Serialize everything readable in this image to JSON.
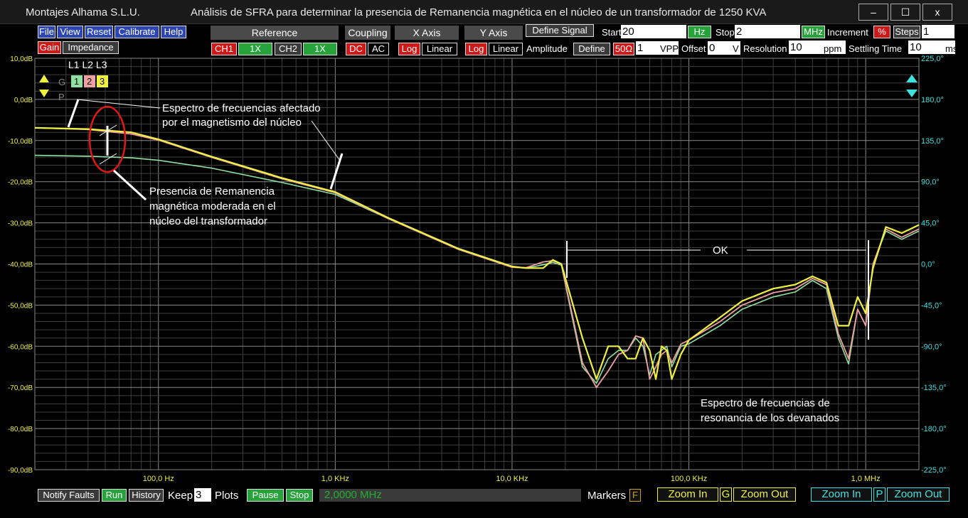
{
  "window": {
    "company": "Montajes Alhama S.L.U.",
    "title": "Análisis de SFRA para determinar la presencia de Remanencia magnética en el núcleo de un transformador de 1250 KVA",
    "minimize": "–",
    "maximize": "☐",
    "close": "x"
  },
  "menu": {
    "file": "File",
    "view": "View",
    "reset": "Reset",
    "calibrate": "Calibrate",
    "help": "Help"
  },
  "mode": {
    "gain": "Gain",
    "impedance": "Impedance"
  },
  "reference": {
    "header": "Reference",
    "ch1": "CH1",
    "ch1_mult": "1X",
    "ch2": "CH2",
    "ch2_mult": "1X"
  },
  "coupling": {
    "header": "Coupling",
    "dc": "DC",
    "ac": "AC"
  },
  "xaxis": {
    "header": "X Axis",
    "log": "Log",
    "linear": "Linear"
  },
  "yaxis": {
    "header": "Y Axis",
    "log": "Log",
    "linear": "Linear"
  },
  "signal": {
    "define_signal": "Define Signal",
    "amplitude_label": "Amplitude",
    "define": "Define",
    "impedance": "50Ω",
    "amplitude_value": "1",
    "amplitude_unit": "VPP",
    "offset_label": "Offset",
    "offset_value": "0",
    "offset_unit": "V"
  },
  "sweep": {
    "start_label": "Start",
    "start_value": "20",
    "start_unit": "Hz",
    "stop_label": "Stop",
    "stop_value": "2",
    "stop_unit": "MHz",
    "increment_label": "Increment",
    "increment_unit": "%",
    "steps_label": "Steps",
    "steps_value": "1",
    "resolution_label": "Resolution",
    "resolution_value": "10",
    "resolution_unit": "ppm",
    "settling_label": "Settling Time",
    "settling_value": "10",
    "settling_unit": "ms"
  },
  "legend": {
    "header": "L1 L2 L3",
    "g": "G",
    "p": "P",
    "l1": "1",
    "l2": "2",
    "l3": "3"
  },
  "bottom": {
    "notify": "Notify Faults",
    "run": "Run",
    "history": "History",
    "keep_label": "Keep",
    "keep_value": "3",
    "plots_label": "Plots",
    "pause": "Pause",
    "stop": "Stop",
    "frequency": "2,0000 MHz",
    "markers": "Markers",
    "markers_flag": "F",
    "zoom_in_g": "Zoom In",
    "g": "G",
    "zoom_out_g": "Zoom Out",
    "zoom_in_p": "Zoom In",
    "p": "P",
    "zoom_out_p": "Zoom Out"
  },
  "colors": {
    "l1": "#90e0a0",
    "l2": "#f0a0a0",
    "l3": "#f0f040",
    "grid_major": "#8a8a8a",
    "grid_minor": "#3e3e3e",
    "left_axis": "#f0f040",
    "right_axis": "#40e0e0"
  },
  "chart_data": {
    "type": "line",
    "x_scale": "log",
    "xlim": [
      20,
      2000000
    ],
    "ylim": [
      -90,
      10
    ],
    "y2lim": [
      -225,
      225
    ],
    "x_ticks": [
      100,
      1000,
      10000,
      100000,
      1000000
    ],
    "x_tick_labels": [
      "100,0 Hz",
      "1,0 KHz",
      "10,0 KHz",
      "100,0 KHz",
      "1,0 MHz"
    ],
    "y_ticks": [
      10,
      0,
      -10,
      -20,
      -30,
      -40,
      -50,
      -60,
      -70,
      -80,
      -90
    ],
    "y_tick_labels": [
      "10,0dB",
      "0,0dB",
      "-10,0dB",
      "-20,0dB",
      "-30,0dB",
      "-40,0dB",
      "-50,0dB",
      "-60,0dB",
      "-70,0dB",
      "-80,0dB",
      "-90,0dB"
    ],
    "y2_ticks": [
      225,
      180,
      135,
      90,
      45,
      0,
      -45,
      -90,
      -135,
      -180,
      -225
    ],
    "y2_tick_labels": [
      "225,0°",
      "180,0°",
      "135,0°",
      "90,0°",
      "45,0°",
      "0,0°",
      "-45,0°",
      "-90,0°",
      "-135,0°",
      "-180,0°",
      "-225,0°"
    ],
    "grid": true,
    "series": [
      {
        "name": "1",
        "x": [
          20,
          40,
          70,
          100,
          200,
          500,
          1000,
          2000,
          5000,
          10000,
          12000,
          15000,
          17000,
          19000,
          25000,
          30000,
          35000,
          40000,
          45000,
          50000,
          55000,
          60000,
          65000,
          70000,
          75000,
          80000,
          90000,
          100000,
          150000,
          200000,
          300000,
          400000,
          500000,
          600000,
          700000,
          800000,
          900000,
          1000000,
          1100000,
          1300000,
          1600000,
          2000000
        ],
        "y": [
          -13.6,
          -13.8,
          -14.2,
          -14.8,
          -16.7,
          -20.2,
          -23.1,
          -29.0,
          -36.5,
          -40.8,
          -41.0,
          -40.2,
          -39.6,
          -40.3,
          -65.0,
          -69.0,
          -63.0,
          -61.0,
          -61.0,
          -58.0,
          -60.0,
          -67.0,
          -62.0,
          -61.0,
          -60.0,
          -65.0,
          -60.0,
          -59.4,
          -55.0,
          -51.0,
          -48.0,
          -46.8,
          -44.0,
          -46.0,
          -58.0,
          -64.3,
          -51.0,
          -55.0,
          -40.0,
          -32.0,
          -34.0,
          -32.0
        ]
      },
      {
        "name": "2",
        "x": [
          20,
          40,
          70,
          100,
          200,
          500,
          1000,
          2000,
          5000,
          10000,
          12000,
          15000,
          17000,
          19000,
          25000,
          30000,
          35000,
          40000,
          45000,
          50000,
          55000,
          60000,
          65000,
          70000,
          75000,
          80000,
          90000,
          100000,
          150000,
          200000,
          300000,
          400000,
          500000,
          600000,
          700000,
          800000,
          900000,
          1000000,
          1100000,
          1300000,
          1600000,
          2000000
        ],
        "y": [
          -6.9,
          -7.3,
          -8.4,
          -9.9,
          -14.1,
          -19.3,
          -22.7,
          -29.0,
          -36.5,
          -40.8,
          -40.9,
          -39.5,
          -39.2,
          -40.0,
          -64.0,
          -70.0,
          -66.0,
          -62.0,
          -61.0,
          -57.5,
          -58.0,
          -68.0,
          -65.0,
          -62.0,
          -61.0,
          -64.0,
          -59.5,
          -58.5,
          -54.0,
          -50.0,
          -47.0,
          -46.0,
          -43.5,
          -45.0,
          -57.0,
          -63.0,
          -51.0,
          -55.0,
          -40.0,
          -31.5,
          -33.5,
          -31.5
        ]
      },
      {
        "name": "3",
        "x": [
          20,
          40,
          70,
          100,
          200,
          500,
          1000,
          2000,
          5000,
          10000,
          12000,
          15000,
          17000,
          19000,
          25000,
          30000,
          35000,
          40000,
          45000,
          50000,
          55000,
          60000,
          65000,
          70000,
          75000,
          80000,
          90000,
          100000,
          150000,
          200000,
          300000,
          400000,
          500000,
          600000,
          700000,
          800000,
          900000,
          1000000,
          1100000,
          1300000,
          1600000,
          2000000
        ],
        "y": [
          -6.9,
          -7.2,
          -8.0,
          -9.7,
          -13.9,
          -19.1,
          -22.5,
          -28.8,
          -36.3,
          -40.6,
          -41.0,
          -41.0,
          -39.0,
          -40.0,
          -58.0,
          -68.0,
          -60.0,
          -60.0,
          -63.0,
          -63.0,
          -58.0,
          -61.0,
          -68.0,
          -60.0,
          -61.0,
          -68.0,
          -62.0,
          -58.5,
          -53.0,
          -49.0,
          -46.0,
          -45.0,
          -43.0,
          -44.5,
          -55.0,
          -55.0,
          -48.0,
          -52.0,
          -41.0,
          -31.0,
          -32.5,
          -30.5
        ]
      }
    ],
    "annotations": {
      "affected": "Espectro de frecuencias afectado por el magnetismo del núcleo",
      "remanence": "Presencia de Remanencia magnética moderada en el núcleo del transformador",
      "ok": "OK",
      "resonance": "Espectro de frecuencias de resonancia de los devanados"
    }
  }
}
